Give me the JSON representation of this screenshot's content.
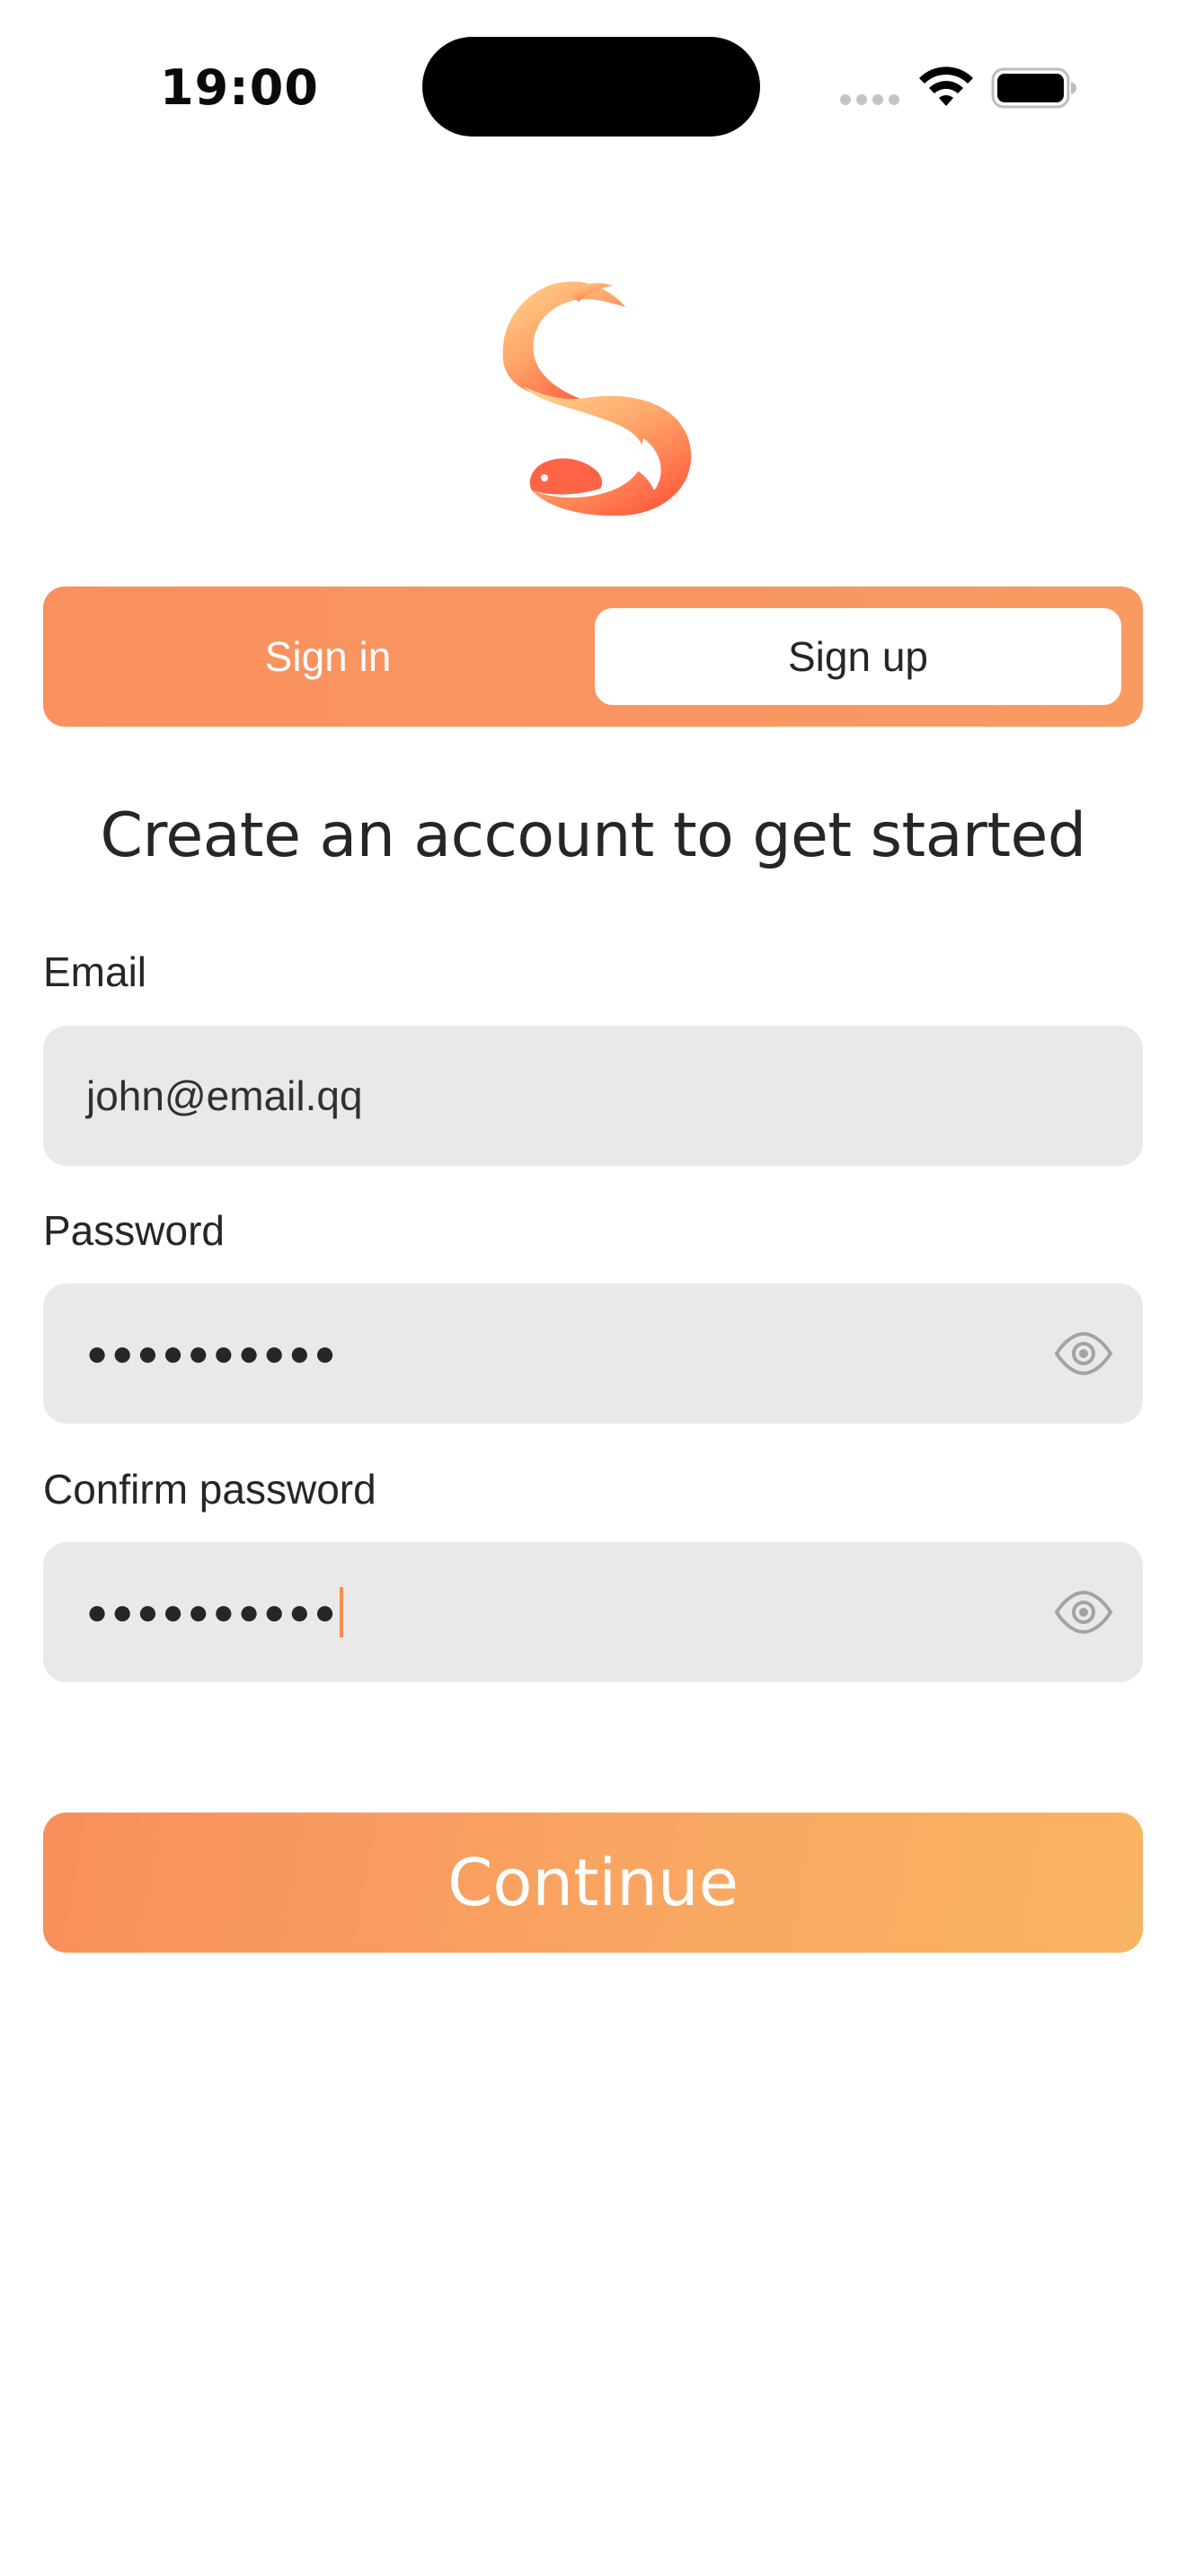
{
  "status_bar": {
    "time": "19:00"
  },
  "auth_tabs": {
    "sign_in_label": "Sign in",
    "sign_up_label": "Sign up",
    "selected": "Sign up"
  },
  "heading": "Create an account to get started",
  "form": {
    "email": {
      "label": "Email",
      "value": "john@email.qq"
    },
    "password": {
      "label": "Password",
      "masked_value": "●●●●●●●●●●"
    },
    "confirm_password": {
      "label": "Confirm password",
      "masked_value": "●●●●●●●●●●"
    }
  },
  "continue_label": "Continue",
  "icons": {
    "logo": "squirrel-s-logo",
    "password_toggle": "eye-icon",
    "wifi": "wifi-icon",
    "battery": "battery-icon",
    "signal": "signal-dots-icon"
  },
  "colors": {
    "accent": "#f9905e",
    "accent_end": "#f9b463",
    "field_background": "#e9e9e9",
    "caret": "#f58c55"
  }
}
